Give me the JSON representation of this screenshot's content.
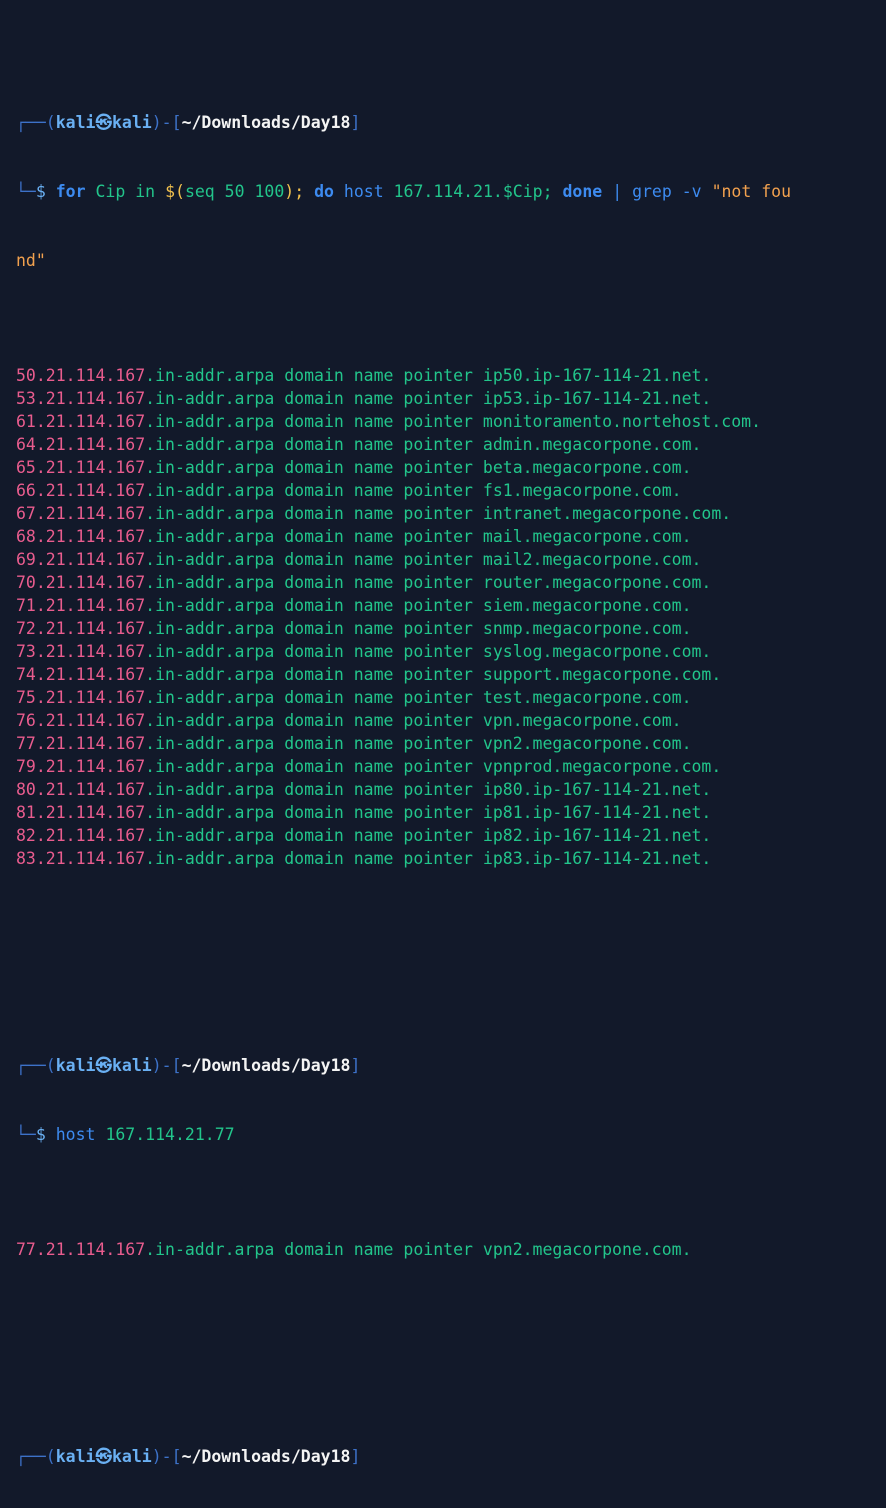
{
  "prompt": {
    "user": "kali",
    "sep": "㉿",
    "host": "kali",
    "path": "~/Downloads/Day18",
    "dollar": "$",
    "frame_top_left": "┌──(",
    "frame_mid": ")-[",
    "frame_end": "]",
    "frame_bottom": "└─"
  },
  "command1": {
    "kw_for": "for",
    "var": "Cip",
    "kw_in": "in",
    "subst_open": "$(",
    "subst_body": "seq 50 100",
    "subst_close": ");",
    "kw_do": "do",
    "cmd_host": "host",
    "arg": "167.114.21.",
    "arg_var": "$Cip",
    "semi": ";",
    "kw_done": "done",
    "pipe": "|",
    "cmd_grep": "grep",
    "flag": "-v",
    "pattern_part1": "\"not fou",
    "pattern_part2": "nd\""
  },
  "output1": [
    {
      "ip": "50.21.114.167",
      "rest": ".in-addr.arpa domain name pointer ip50.ip-167-114-21.net."
    },
    {
      "ip": "53.21.114.167",
      "rest": ".in-addr.arpa domain name pointer ip53.ip-167-114-21.net."
    },
    {
      "ip": "61.21.114.167",
      "rest": ".in-addr.arpa domain name pointer monitoramento.nortehost.com."
    },
    {
      "ip": "64.21.114.167",
      "rest": ".in-addr.arpa domain name pointer admin.megacorpone.com."
    },
    {
      "ip": "65.21.114.167",
      "rest": ".in-addr.arpa domain name pointer beta.megacorpone.com."
    },
    {
      "ip": "66.21.114.167",
      "rest": ".in-addr.arpa domain name pointer fs1.megacorpone.com."
    },
    {
      "ip": "67.21.114.167",
      "rest": ".in-addr.arpa domain name pointer intranet.megacorpone.com."
    },
    {
      "ip": "68.21.114.167",
      "rest": ".in-addr.arpa domain name pointer mail.megacorpone.com."
    },
    {
      "ip": "69.21.114.167",
      "rest": ".in-addr.arpa domain name pointer mail2.megacorpone.com."
    },
    {
      "ip": "70.21.114.167",
      "rest": ".in-addr.arpa domain name pointer router.megacorpone.com."
    },
    {
      "ip": "71.21.114.167",
      "rest": ".in-addr.arpa domain name pointer siem.megacorpone.com."
    },
    {
      "ip": "72.21.114.167",
      "rest": ".in-addr.arpa domain name pointer snmp.megacorpone.com."
    },
    {
      "ip": "73.21.114.167",
      "rest": ".in-addr.arpa domain name pointer syslog.megacorpone.com."
    },
    {
      "ip": "74.21.114.167",
      "rest": ".in-addr.arpa domain name pointer support.megacorpone.com."
    },
    {
      "ip": "75.21.114.167",
      "rest": ".in-addr.arpa domain name pointer test.megacorpone.com."
    },
    {
      "ip": "76.21.114.167",
      "rest": ".in-addr.arpa domain name pointer vpn.megacorpone.com."
    },
    {
      "ip": "77.21.114.167",
      "rest": ".in-addr.arpa domain name pointer vpn2.megacorpone.com."
    },
    {
      "ip": "79.21.114.167",
      "rest": ".in-addr.arpa domain name pointer vpnprod.megacorpone.com."
    },
    {
      "ip": "80.21.114.167",
      "rest": ".in-addr.arpa domain name pointer ip80.ip-167-114-21.net."
    },
    {
      "ip": "81.21.114.167",
      "rest": ".in-addr.arpa domain name pointer ip81.ip-167-114-21.net."
    },
    {
      "ip": "82.21.114.167",
      "rest": ".in-addr.arpa domain name pointer ip82.ip-167-114-21.net."
    },
    {
      "ip": "83.21.114.167",
      "rest": ".in-addr.arpa domain name pointer ip83.ip-167-114-21.net."
    }
  ],
  "command2": {
    "cmd_host": "host",
    "arg": "167.114.21.77"
  },
  "output2": [
    {
      "ip": "77.21.114.167",
      "rest": ".in-addr.arpa domain name pointer vpn2.megacorpone.com."
    }
  ],
  "colors": {
    "background": "#12192a",
    "prompt_frame": "#3d72c9",
    "ip_text": "#e95c8e",
    "domain_text": "#22c58b",
    "keyword": "#3d8bf0",
    "string": "#f2a14e"
  }
}
